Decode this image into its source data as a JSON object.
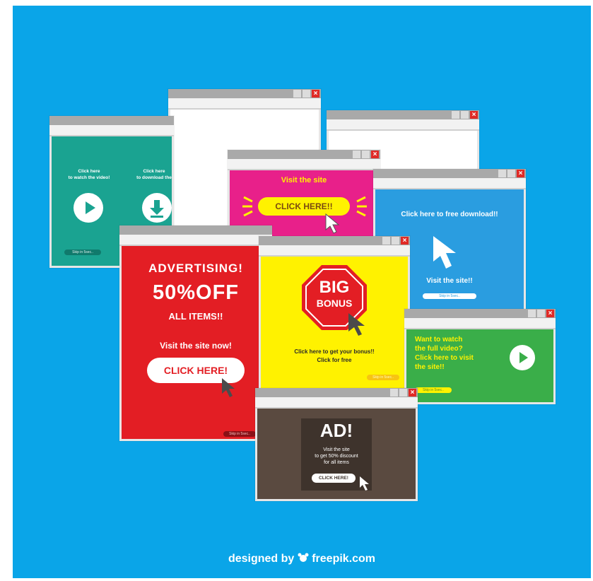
{
  "green_video": {
    "watch_text": "Click here\nto watch the video!",
    "download_text": "Click here\nto download the",
    "skip": "Skip in 5sec.."
  },
  "pink": {
    "visit": "Visit the site",
    "button": "CLICK HERE!!"
  },
  "blue_download": {
    "text": "Click here to free download!!",
    "visit": "Visit the site!!",
    "skip": "Skip in 5sec.."
  },
  "red": {
    "line1": "ADVERTISING!",
    "line2": "50%OFF",
    "line3": "ALL ITEMS!!",
    "visit": "Visit the site now!",
    "button": "CLICK HERE!",
    "skip": "Skip in 5sec.."
  },
  "yellow": {
    "big": "BIG",
    "bonus": "BONUS",
    "text1": "Click here to get your bonus!!",
    "text2": "Click for free",
    "skip": "Skip in 5sec.."
  },
  "green_full": {
    "text": "Want to watch\nthe full video?\nClick here to visit\nthe site!!",
    "skip": "Skip in 5sec.."
  },
  "brown": {
    "ad": "AD!",
    "text": "Visit the site\nto get 50% discount\nfor all items",
    "button": "CLICK HERE!"
  },
  "footer": {
    "designed_by": "designed by",
    "brand": "freepik.com"
  },
  "colors": {
    "background": "#0aa5e8",
    "green": "#1aa391",
    "pink": "#e8208a",
    "blue": "#2a9de0",
    "red": "#e31e24",
    "yellow": "#fff200",
    "green2": "#3aae49",
    "brown": "#5a4a40"
  }
}
